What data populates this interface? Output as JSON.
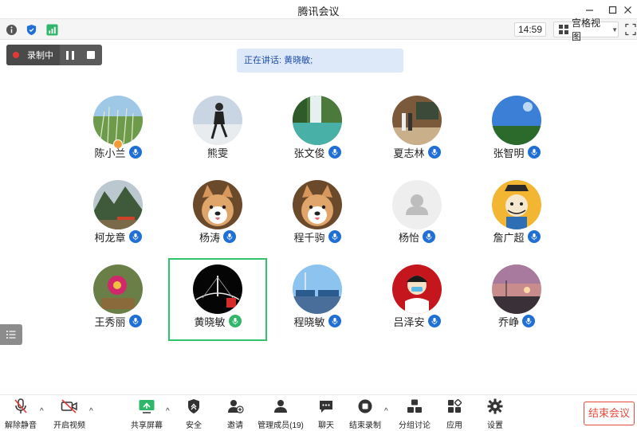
{
  "window": {
    "title": "腾讯会议"
  },
  "status": {
    "time": "14:59",
    "view_label": "宫格视图"
  },
  "recording": {
    "label": "录制中"
  },
  "speaking": {
    "text": "正在讲话: 黄晓敏;"
  },
  "participants": [
    {
      "name": "陈小兰",
      "mic": "blue",
      "host": true,
      "avatar": "grass-photo"
    },
    {
      "name": "熊雯",
      "mic": "none",
      "host": false,
      "avatar": "person-photo"
    },
    {
      "name": "张文俊",
      "mic": "blue",
      "host": false,
      "avatar": "waterfall-photo"
    },
    {
      "name": "夏志林",
      "mic": "blue",
      "host": false,
      "avatar": "room-photo"
    },
    {
      "name": "张智明",
      "mic": "blue",
      "host": false,
      "avatar": "sky-photo"
    },
    {
      "name": "柯龙章",
      "mic": "blue",
      "host": false,
      "avatar": "mountain-photo"
    },
    {
      "name": "杨涛",
      "mic": "blue",
      "host": false,
      "avatar": "dog-photo"
    },
    {
      "name": "程千驹",
      "mic": "blue",
      "host": false,
      "avatar": "dog-photo"
    },
    {
      "name": "杨怡",
      "mic": "blue",
      "host": false,
      "avatar": "default-avatar"
    },
    {
      "name": "詹广超",
      "mic": "blue",
      "host": false,
      "avatar": "cartoon-photo"
    },
    {
      "name": "王秀丽",
      "mic": "blue",
      "host": false,
      "avatar": "flower-photo"
    },
    {
      "name": "黄晓敏",
      "mic": "green",
      "host": false,
      "avatar": "bridge-photo",
      "active": true
    },
    {
      "name": "程晓敏",
      "mic": "blue-solid",
      "host": false,
      "avatar": "solar-photo"
    },
    {
      "name": "吕泽安",
      "mic": "blue",
      "host": false,
      "avatar": "cartoon-red-photo"
    },
    {
      "name": "乔峥",
      "mic": "blue",
      "host": false,
      "avatar": "sunset-photo"
    }
  ],
  "toolbar": {
    "unmute": "解除静音",
    "video": "开启视频",
    "share": "共享屏幕",
    "security": "安全",
    "invite": "邀请",
    "members": "管理成员(19)",
    "chat": "聊天",
    "end_record": "结束录制",
    "breakout": "分组讨论",
    "apps": "应用",
    "settings": "设置",
    "end_meeting": "结束会议"
  },
  "colors": {
    "accent": "#1f6fd6",
    "active_border": "#2fc36a",
    "end": "#e74a3b",
    "rec": "#e53935"
  }
}
